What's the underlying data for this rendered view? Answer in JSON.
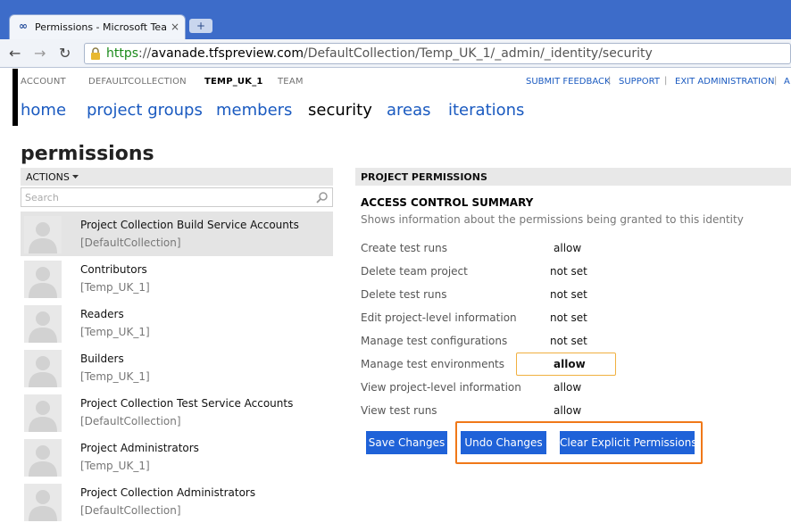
{
  "browser": {
    "tab_title": "Permissions - Microsoft Team F",
    "tab_close": "×",
    "new_tab": "+",
    "url_scheme": "https",
    "url_host": "avanade.tfspreview.com",
    "url_path": "/DefaultCollection/Temp_UK_1/_admin/_identity/security",
    "url_separator": "://"
  },
  "breadcrumbs": [
    "ACCOUNT",
    "DEFAULTCOLLECTION",
    "TEMP_UK_1",
    "TEAM"
  ],
  "top_links": [
    "SUBMIT FEEDBACK",
    "SUPPORT",
    "EXIT ADMINISTRATION",
    "A"
  ],
  "link_separator": "|",
  "main_nav": [
    "home",
    "project groups",
    "members",
    "security",
    "areas",
    "iterations"
  ],
  "page_title": "permissions",
  "left_panel": {
    "actions_label": "ACTIONS",
    "search_placeholder": "Search",
    "identities": [
      {
        "name": "Project Collection Build Service Accounts",
        "scope": "[DefaultCollection]"
      },
      {
        "name": "Contributors",
        "scope": "[Temp_UK_1]"
      },
      {
        "name": "Readers",
        "scope": "[Temp_UK_1]"
      },
      {
        "name": "Builders",
        "scope": "[Temp_UK_1]"
      },
      {
        "name": "Project Collection Test Service Accounts",
        "scope": "[DefaultCollection]"
      },
      {
        "name": "Project Administrators",
        "scope": "[Temp_UK_1]"
      },
      {
        "name": "Project Collection Administrators",
        "scope": "[DefaultCollection]"
      }
    ]
  },
  "right_panel": {
    "header": "PROJECT PERMISSIONS",
    "summary_title": "ACCESS CONTROL SUMMARY",
    "summary_desc": "Shows information about the permissions being granted to this identity",
    "permissions": [
      {
        "name": "Create test runs",
        "value": "allow"
      },
      {
        "name": "Delete team project",
        "value": "not set"
      },
      {
        "name": "Delete test runs",
        "value": "not set"
      },
      {
        "name": "Edit project-level information",
        "value": "not set"
      },
      {
        "name": "Manage test configurations",
        "value": "not set"
      },
      {
        "name": "Manage test environments",
        "value": "allow"
      },
      {
        "name": "View project-level information",
        "value": "allow"
      },
      {
        "name": "View test runs",
        "value": "allow"
      }
    ],
    "buttons": {
      "save": "Save Changes",
      "undo": "Undo Changes",
      "clear": "Clear Explicit Permissions"
    }
  },
  "colors": {
    "link": "#1a5ac0",
    "button": "#1f62d8",
    "highlight": "#f07818",
    "edited_box": "#f0b040"
  }
}
